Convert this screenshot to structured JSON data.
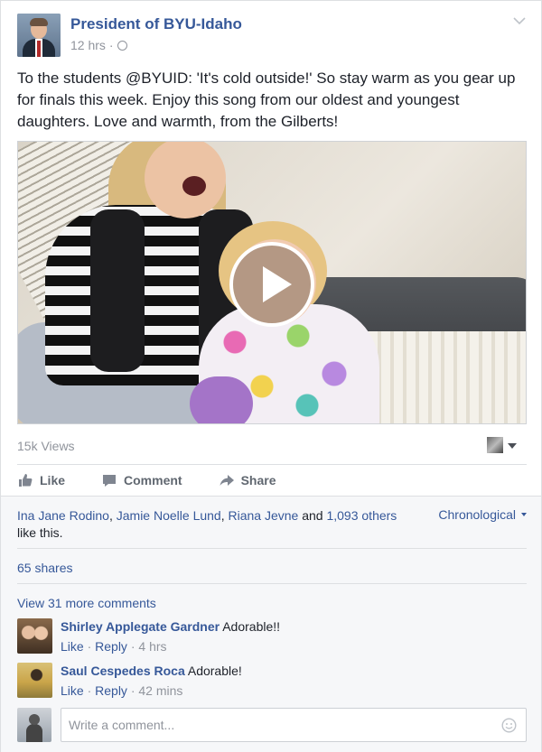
{
  "post": {
    "page_name": "President of BYU-Idaho",
    "time": "12 hrs",
    "separator": "·",
    "text": "To the students @BYUID: 'It's cold outside!' So stay warm as you gear up for finals this week. Enjoy this song from our oldest and youngest daughters. Love and warmth, from the Gilberts!",
    "views": "15k Views"
  },
  "actions": {
    "like": "Like",
    "comment": "Comment",
    "share": "Share"
  },
  "feedback": {
    "likers": [
      "Ina Jane Rodino",
      "Jamie Noelle Lund",
      "Riana Jevne"
    ],
    "and_text": "and",
    "others": "1,093 others",
    "like_suffix": "like this.",
    "sort_label": "Chronological",
    "shares": "65 shares",
    "more_comments": "View 31 more comments"
  },
  "comments": [
    {
      "name": "Shirley Applegate Gardner",
      "text": "Adorable!!",
      "like": "Like",
      "reply": "Reply",
      "time": "4 hrs"
    },
    {
      "name": "Saul Cespedes Roca",
      "text": "Adorable!",
      "like": "Like",
      "reply": "Reply",
      "time": "42 mins"
    }
  ],
  "composer": {
    "placeholder": "Write a comment..."
  },
  "colors": {
    "link": "#365899",
    "muted": "#90949c",
    "background": "#f6f7f9"
  },
  "icons": [
    "chevron-down-icon",
    "globe-icon",
    "play-icon",
    "like-icon",
    "comment-icon",
    "share-icon",
    "caret-down-icon",
    "smiley-icon"
  ]
}
